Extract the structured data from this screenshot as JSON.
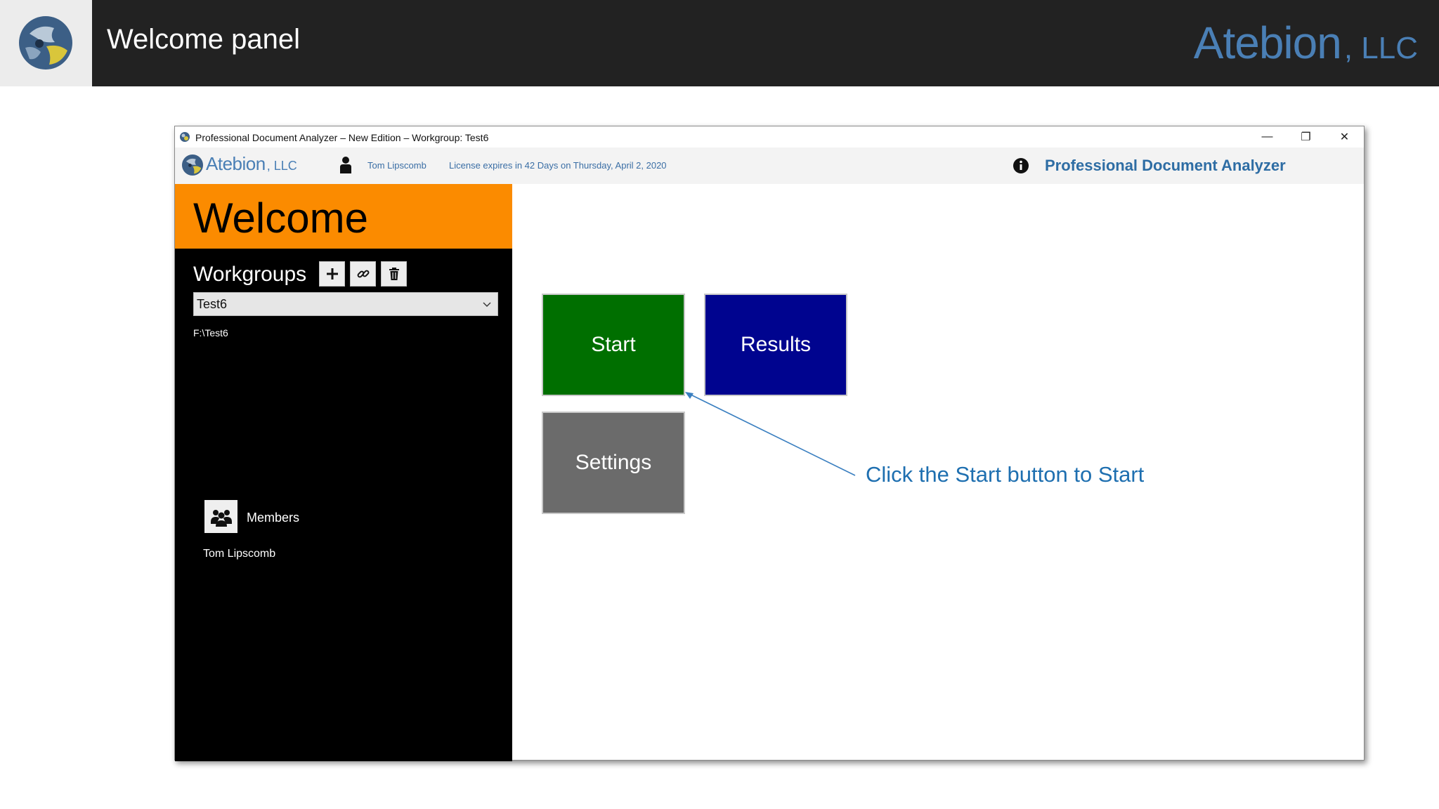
{
  "slide": {
    "title": "Welcome panel",
    "brand_main": "Atebion",
    "brand_llc": ", LLC"
  },
  "window": {
    "title": "Professional Document Analyzer – New Edition – Workgroup: Test6",
    "controls": {
      "minimize": "—",
      "maximize": "❐",
      "close": "✕"
    }
  },
  "toolbar": {
    "brand_main": "Atebion",
    "brand_llc": ", LLC",
    "user": "Tom Lipscomb",
    "license": "License expires in 42 Days on Thursday, April 2, 2020",
    "product": "Professional Document Analyzer"
  },
  "left_panel": {
    "welcome": "Welcome",
    "workgroups_label": "Workgroups",
    "selected_workgroup": "Test6",
    "workgroup_path": "F:\\Test6",
    "members_label": "Members",
    "members": [
      "Tom Lipscomb"
    ]
  },
  "tiles": {
    "start": "Start",
    "results": "Results",
    "settings": "Settings"
  },
  "annotation": {
    "text": "Click the Start button to Start"
  },
  "colors": {
    "header_bg": "#222222",
    "brand_blue": "#4a7fb5",
    "welcome_orange": "#fb8b00",
    "start_green": "#006f00",
    "results_blue": "#00048f",
    "settings_gray": "#6b6b6b",
    "annotation_blue": "#1e6fb0"
  },
  "icons": [
    "atebion-logo-icon",
    "user-icon",
    "info-icon",
    "plus-icon",
    "link-icon",
    "trash-icon",
    "chevron-down-icon",
    "members-icon"
  ]
}
